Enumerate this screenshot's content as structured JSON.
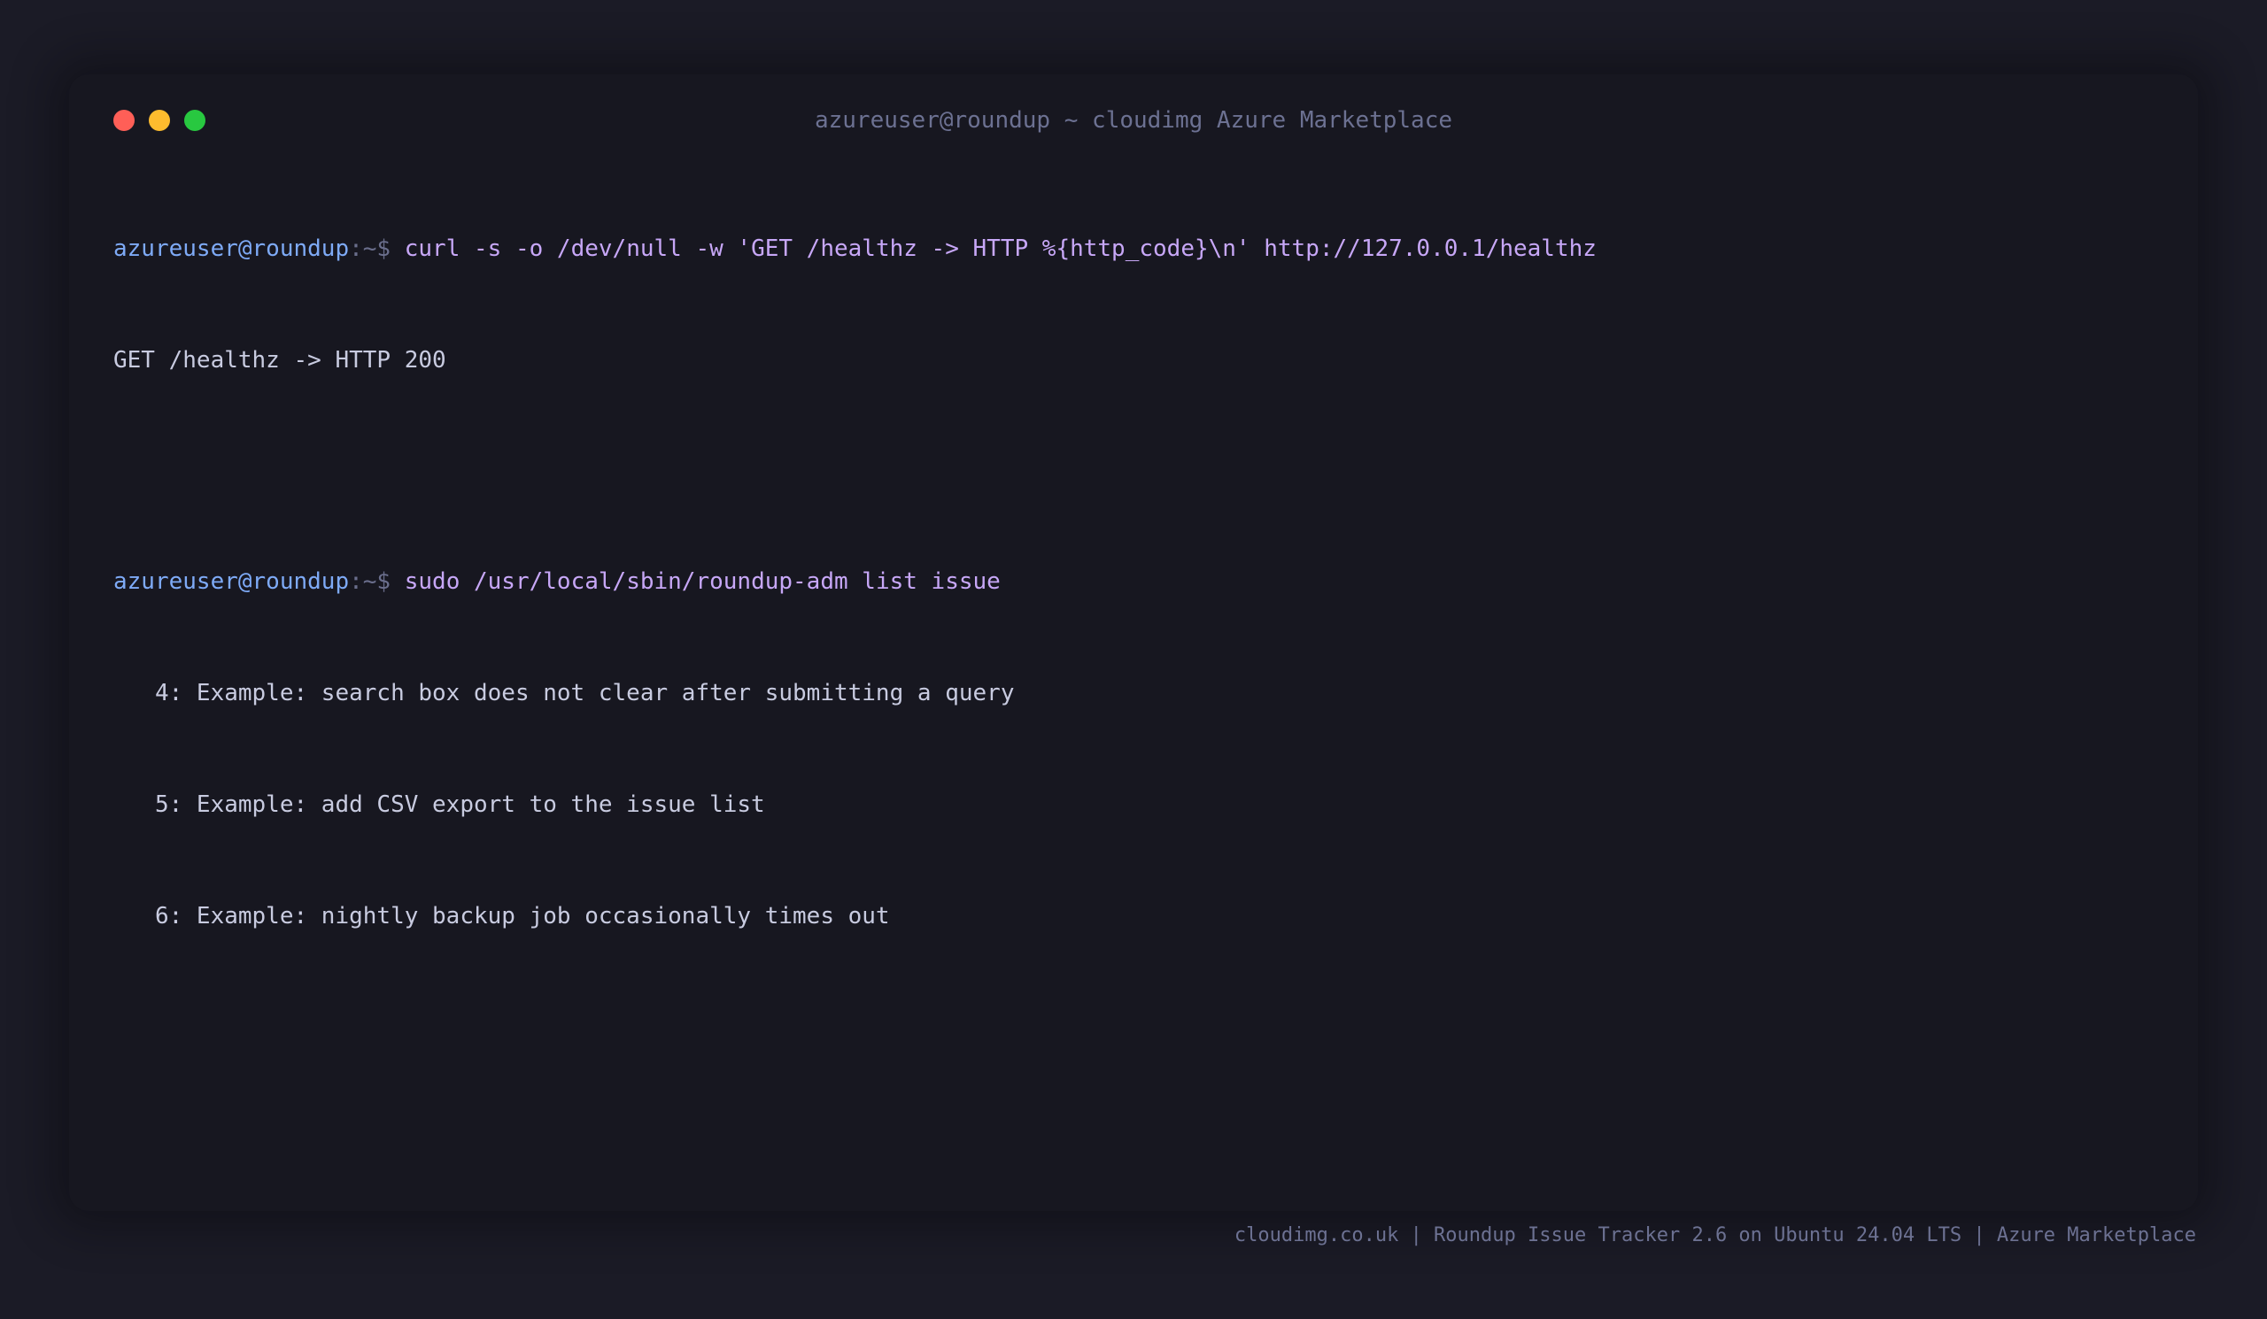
{
  "window": {
    "title": "azureuser@roundup ~ cloudimg Azure Marketplace",
    "controls": {
      "close_color": "#ff5f57",
      "minimize_color": "#febc2e",
      "maximize_color": "#28c840"
    }
  },
  "colors": {
    "prompt_user": "#7eaaf6",
    "prompt_separator": "#6a6e8c",
    "command": "#c7a7f7",
    "output": "#c8cbe0"
  },
  "terminal": {
    "block1": {
      "prompt_user": "azureuser@roundup",
      "prompt_separator": ":~$",
      "command": "curl -s -o /dev/null -w 'GET /healthz -> HTTP %{http_code}\\n' http://127.0.0.1/healthz",
      "output": "GET /healthz -> HTTP 200"
    },
    "block2": {
      "prompt_user": "azureuser@roundup",
      "prompt_separator": ":~$",
      "command": "sudo /usr/local/sbin/roundup-adm list issue",
      "output_lines": [
        "   4: Example: search box does not clear after submitting a query",
        "   5: Example: add CSV export to the issue list",
        "   6: Example: nightly backup job occasionally times out"
      ]
    }
  },
  "footer": {
    "text": "cloudimg.co.uk | Roundup Issue Tracker 2.6 on Ubuntu 24.04 LTS | Azure Marketplace"
  }
}
